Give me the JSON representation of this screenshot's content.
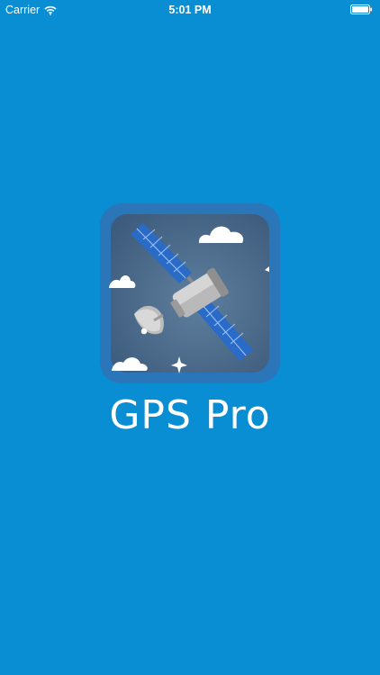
{
  "status_bar": {
    "carrier": "Carrier",
    "time": "5:01 PM",
    "wifi_icon": "wifi-icon",
    "battery_icon": "battery-icon"
  },
  "splash": {
    "app_name": "GPS Pro",
    "icon": "satellite-icon",
    "background_color": "#0a8ed3"
  }
}
